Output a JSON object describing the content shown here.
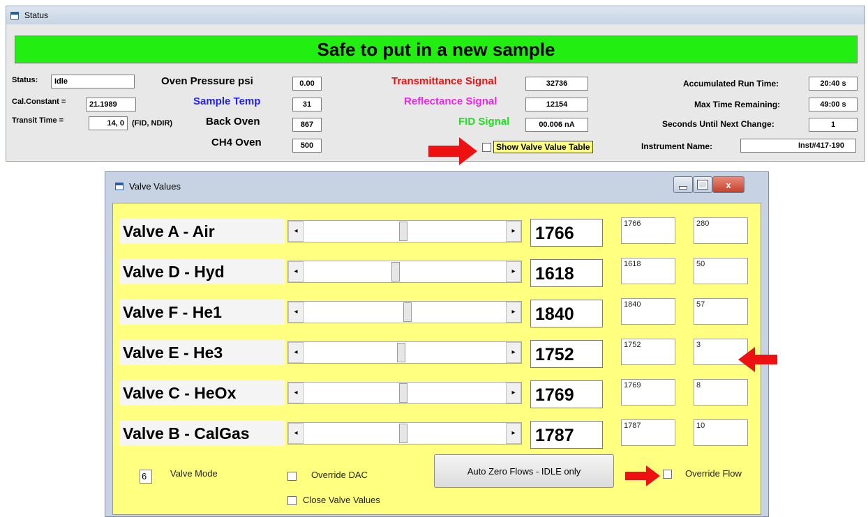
{
  "status_window": {
    "title": "Status",
    "banner": "Safe to put in a new sample",
    "banner_color": "#22ee11",
    "status_label": "Status:",
    "status_value": "Idle",
    "cal_label": "Cal.Constant =",
    "cal_value": "21.1989",
    "transit_label": "Transit Time =",
    "transit_value": "14, 0",
    "transit_suffix": "(FID, NDIR)",
    "oven_pressure_label": "Oven Pressure psi",
    "oven_pressure_value": "0.00",
    "sample_temp_label": "Sample Temp",
    "sample_temp_value": "31",
    "back_oven_label": "Back Oven",
    "back_oven_value": "867",
    "ch4_oven_label": "CH4 Oven",
    "ch4_oven_value": "500",
    "transmittance_label": "Transmittance Signal",
    "transmittance_value": "32736",
    "reflectance_label": "Reflectance Signal",
    "reflectance_value": "12154",
    "fid_label": "FID Signal",
    "fid_value": "00.006 nA",
    "show_valve_table_label": "Show Valve Value Table",
    "accum_label": "Accumulated Run Time:",
    "accum_value": "20:40 s",
    "max_time_label": "Max Time Remaining:",
    "max_time_value": "49:00 s",
    "seconds_label": "Seconds Until Next Change:",
    "seconds_value": "1",
    "instrument_label": "Instrument Name:",
    "instrument_value": "Inst#417-190",
    "colors": {
      "transmittance": "#ee1111",
      "reflectance": "#ee22ee",
      "fid": "#22dd22",
      "sample_temp": "#2222ee",
      "arrow": "#ee1111"
    }
  },
  "valve_window": {
    "title": "Valve Values",
    "valves": [
      {
        "name": "Valve A - Air",
        "value": "1766",
        "dac": "1766",
        "flow": "280",
        "slider_fraction": 0.49
      },
      {
        "name": "Valve D - Hyd",
        "value": "1618",
        "dac": "1618",
        "flow": "50",
        "slider_fraction": 0.45
      },
      {
        "name": "Valve F - He1",
        "value": "1840",
        "dac": "1840",
        "flow": "57",
        "slider_fraction": 0.51
      },
      {
        "name": "Valve E - He3",
        "value": "1752",
        "dac": "1752",
        "flow": "3",
        "slider_fraction": 0.48
      },
      {
        "name": "Valve C - HeOx",
        "value": "1769",
        "dac": "1769",
        "flow": "8",
        "slider_fraction": 0.49
      },
      {
        "name": "Valve B - CalGas",
        "value": "1787",
        "dac": "1787",
        "flow": "10",
        "slider_fraction": 0.49
      }
    ],
    "valve_mode_value": "6",
    "valve_mode_label": "Valve Mode",
    "override_dac_label": "Override DAC",
    "close_valve_label": "Close Valve Values",
    "auto_zero_label": "Auto Zero Flows - IDLE only",
    "override_flow_label": "Override Flow",
    "client_color": "#ffff80"
  }
}
